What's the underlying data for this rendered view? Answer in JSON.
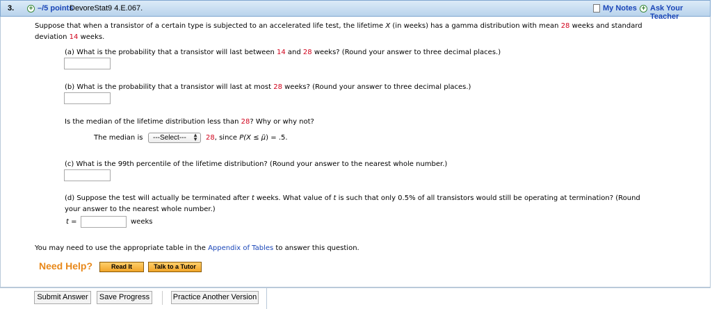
{
  "header": {
    "question_number": "3.",
    "points": "–/5 points",
    "code": "DevoreStat9 4.E.067.",
    "my_notes": "My Notes",
    "ask_teacher": "Ask Your Teacher"
  },
  "intro": {
    "line1_a": "Suppose that when a transistor of a certain type is subjected to an accelerated life test, the lifetime ",
    "var_x": "X",
    "line1_b": " (in weeks) has a gamma distribution with mean ",
    "mean": "28",
    "line1_c": " weeks and standard",
    "line2_a": "deviation ",
    "sd": "14",
    "line2_b": " weeks."
  },
  "part_a": {
    "text_a": "(a) What is the probability that a transistor will last between ",
    "v1": "14",
    "text_b": " and ",
    "v2": "28",
    "text_c": " weeks? (Round your answer to three decimal places.)",
    "answer": ""
  },
  "part_b": {
    "text_a": "(b) What is the probability that a transistor will last at most ",
    "v1": "28",
    "text_b": " weeks? (Round your answer to three decimal places.)",
    "answer": ""
  },
  "median": {
    "question_a": "Is the median of the lifetime distribution less than ",
    "value": "28",
    "question_b": "? Why or why not?",
    "label": "The median is",
    "select_value": "---Select---",
    "after_value": "28",
    "after_text": ", since ",
    "formula_p": "P(X ≤ ",
    "formula_mu": "μ̃",
    "formula_end": ") = .5."
  },
  "part_c": {
    "text": "(c) What is the 99th percentile of the lifetime distribution? (Round your answer to the nearest whole number.)",
    "answer": ""
  },
  "part_d": {
    "text_a": "(d) Suppose the test will actually be terminated after ",
    "var_t": "t",
    "text_b": " weeks. What value of ",
    "var_t2": "t",
    "text_c": " is such that only 0.5% of all transistors would still be operating at termination? (Round",
    "line2": "your answer to the nearest whole number.)",
    "t_label": "t",
    "equals": " = ",
    "unit": "weeks",
    "answer": ""
  },
  "footer_note": {
    "text_a": "You may need to use the appropriate table in the ",
    "link": "Appendix of Tables",
    "text_b": " to answer this question."
  },
  "help": {
    "title": "Need Help?",
    "read_it": "Read It",
    "talk_tutor": "Talk to a Tutor"
  },
  "buttons": {
    "submit": "Submit Answer",
    "save": "Save Progress",
    "practice": "Practice Another Version"
  },
  "colors": {
    "accent_red": "#d0021b",
    "link_blue": "#1a46b8",
    "help_orange": "#e8881a"
  }
}
